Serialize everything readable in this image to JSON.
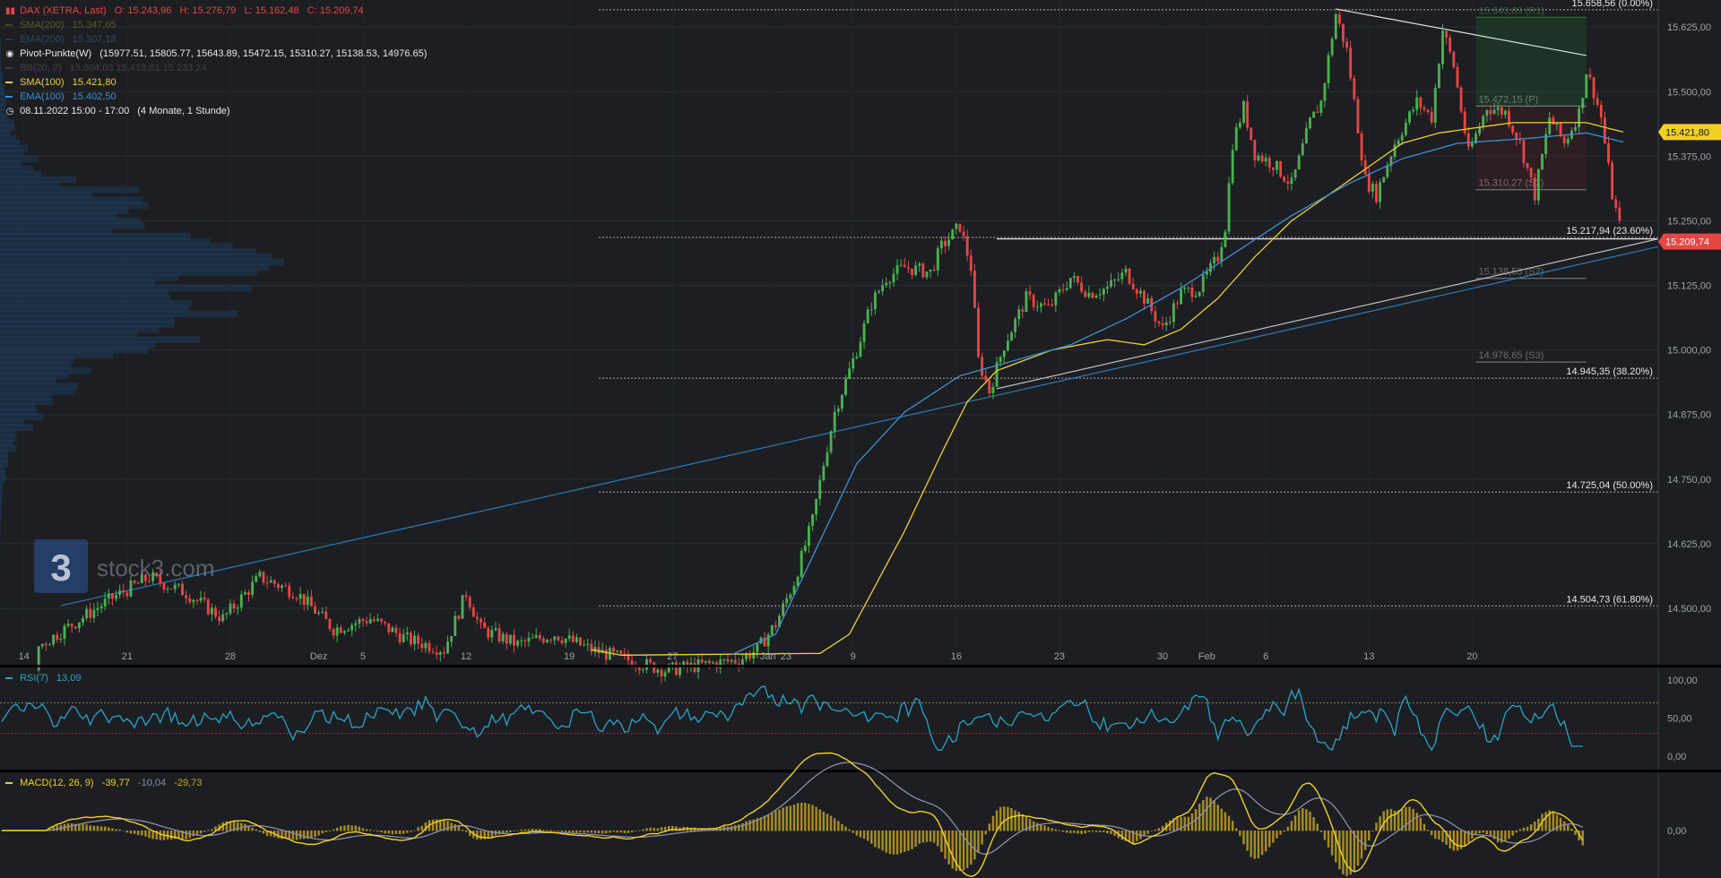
{
  "instrument": {
    "name": "DAX (XETRA, Last)",
    "open": "O: 15.243,96",
    "high": "H: 15.276,79",
    "low": "L: 15.162,48",
    "close": "C: 15.209,74",
    "color": "#e64545"
  },
  "legend": {
    "sma200": {
      "label": "SMA(200)",
      "value": "15.347,65",
      "color": "#9a8c24"
    },
    "ema200": {
      "label": "EMA(200)",
      "value": "15.307,18",
      "color": "#3a6d95"
    },
    "pivot": {
      "label": "Pivot-Punkte(W)",
      "value": "(15977.51,  15805.77,  15643.89,  15472.15,  15310.27,  15138.53,  14976.65)"
    },
    "bbands": {
      "label": "BB(20, 2)",
      "value": "15.604,03  15.418,61  15.233,24"
    },
    "sma100": {
      "label": "SMA(100)",
      "value": "15.421,80",
      "color": "#f2d024"
    },
    "ema100": {
      "label": "EMA(100)",
      "value": "15.402,50",
      "color": "#3d8fd6"
    },
    "range": {
      "label": "08.11.2022 15:00 - 17:00",
      "value": "(4 Monate, 1 Stunde)"
    }
  },
  "watermark": {
    "logo_text": "3",
    "brand": "stock3.com"
  },
  "price_axis": {
    "ticks": [
      "15.625,00",
      "15.500,00",
      "15.375,00",
      "15.250,00",
      "15.125,00",
      "15.000,00",
      "14.875,00",
      "14.750,00",
      "14.625,00",
      "14.500,00"
    ],
    "tick_values": [
      15625,
      15500,
      15375,
      15250,
      15125,
      15000,
      14875,
      14750,
      14625,
      14500
    ],
    "range": [
      14415,
      15660
    ],
    "badges": [
      {
        "text": "15.421,80",
        "value": 15421.8,
        "color": "#f2d024",
        "text_color": "#111111"
      },
      {
        "text": "15.209,74",
        "value": 15209.74,
        "color": "#e64545",
        "text_color": "#ffffff"
      }
    ]
  },
  "time_axis": {
    "labels": [
      "14",
      "21",
      "28",
      "Dez",
      "5",
      "12",
      "19",
      "27",
      "Jan '23",
      "9",
      "16",
      "23",
      "30",
      "Feb",
      "6",
      "13",
      "20"
    ],
    "label_index": [
      6,
      34,
      62,
      86,
      98,
      126,
      154,
      182,
      210,
      231,
      259,
      287,
      315,
      327,
      343,
      371,
      399
    ],
    "bars_total": 430
  },
  "fibonacci": [
    {
      "value": 15658.56,
      "text": "15.658,56 (0.00%)"
    },
    {
      "value": 15217.94,
      "text": "15.217,94 (23.60%)"
    },
    {
      "value": 14945.35,
      "text": "14.945,35 (38.20%)"
    },
    {
      "value": 14725.04,
      "text": "14.725,04 (50.00%)"
    },
    {
      "value": 14504.73,
      "text": "14.504,73 (61.80%)"
    }
  ],
  "pivot_levels": [
    {
      "value": 15643.89,
      "text": "15.643,89 (R1)",
      "color": "#4caf50"
    },
    {
      "value": 15472.15,
      "text": "15.472,15 (P)",
      "color": "#c8c8c8"
    },
    {
      "value": 15310.27,
      "text": "15.310,27 (S1)",
      "color": "#c8c8c8"
    },
    {
      "value": 15138.53,
      "text": "15.138,53 (S2)",
      "color": "#c8c8c8"
    },
    {
      "value": 14976.65,
      "text": "14.976,65 (S3)",
      "color": "#c8c8c8"
    }
  ],
  "rsi": {
    "label": "RSI(7)",
    "value": "13,09",
    "color": "#29a3c9",
    "ticks": [
      "100,00",
      "50,00",
      "0,00"
    ],
    "tick_values": [
      100,
      50,
      0
    ],
    "upper": 70,
    "lower": 30
  },
  "macd": {
    "label": "MACD(12, 26, 9)",
    "value": "-39,77",
    "signal": "-10,04",
    "hist": "-29,73",
    "ticks": [
      "0,00"
    ],
    "line_color": "#f2d024",
    "signal_color": "#8a8fa8",
    "hist_color": "#c9a825"
  },
  "chart_data": {
    "type": "candlestick",
    "title": "DAX (XETRA, Last)",
    "ylim": [
      14415,
      15660
    ],
    "anchor_closes": [
      [
        0,
        14380
      ],
      [
        30,
        14520
      ],
      [
        40,
        14560
      ],
      [
        50,
        14530
      ],
      [
        60,
        14480
      ],
      [
        70,
        14560
      ],
      [
        80,
        14530
      ],
      [
        90,
        14460
      ],
      [
        100,
        14480
      ],
      [
        110,
        14440
      ],
      [
        120,
        14420
      ],
      [
        126,
        14530
      ],
      [
        130,
        14460
      ],
      [
        140,
        14430
      ],
      [
        150,
        14450
      ],
      [
        160,
        14420
      ],
      [
        170,
        14400
      ],
      [
        180,
        14380
      ],
      [
        190,
        14390
      ],
      [
        200,
        14400
      ],
      [
        205,
        14420
      ],
      [
        210,
        14470
      ],
      [
        215,
        14550
      ],
      [
        220,
        14670
      ],
      [
        223,
        14780
      ],
      [
        226,
        14880
      ],
      [
        232,
        15000
      ],
      [
        236,
        15090
      ],
      [
        240,
        15140
      ],
      [
        245,
        15160
      ],
      [
        252,
        15150
      ],
      [
        255,
        15200
      ],
      [
        260,
        15240
      ],
      [
        263,
        15160
      ],
      [
        265,
        14980
      ],
      [
        268,
        14920
      ],
      [
        272,
        15010
      ],
      [
        278,
        15100
      ],
      [
        284,
        15080
      ],
      [
        290,
        15140
      ],
      [
        295,
        15110
      ],
      [
        300,
        15120
      ],
      [
        305,
        15150
      ],
      [
        310,
        15100
      ],
      [
        315,
        15040
      ],
      [
        320,
        15110
      ],
      [
        325,
        15120
      ],
      [
        330,
        15180
      ],
      [
        332,
        15240
      ],
      [
        334,
        15400
      ],
      [
        337,
        15470
      ],
      [
        340,
        15380
      ],
      [
        345,
        15360
      ],
      [
        350,
        15320
      ],
      [
        355,
        15440
      ],
      [
        358,
        15480
      ],
      [
        362,
        15650
      ],
      [
        365,
        15580
      ],
      [
        370,
        15330
      ],
      [
        373,
        15300
      ],
      [
        378,
        15400
      ],
      [
        384,
        15480
      ],
      [
        388,
        15450
      ],
      [
        391,
        15620
      ],
      [
        394,
        15550
      ],
      [
        398,
        15380
      ],
      [
        403,
        15470
      ],
      [
        408,
        15460
      ],
      [
        412,
        15400
      ],
      [
        416,
        15300
      ],
      [
        420,
        15450
      ],
      [
        424,
        15400
      ],
      [
        428,
        15460
      ],
      [
        430,
        15540
      ],
      [
        432,
        15500
      ],
      [
        434,
        15450
      ],
      [
        437,
        15300
      ],
      [
        440,
        15209.74
      ]
    ],
    "sma100_anchors": [
      [
        160,
        14420
      ],
      [
        175,
        14400
      ],
      [
        195,
        14380
      ],
      [
        215,
        14380
      ],
      [
        230,
        14450
      ],
      [
        245,
        14650
      ],
      [
        255,
        14800
      ],
      [
        262,
        14900
      ],
      [
        270,
        14960
      ],
      [
        285,
        15000
      ],
      [
        300,
        15020
      ],
      [
        310,
        15010
      ],
      [
        320,
        15040
      ],
      [
        330,
        15100
      ],
      [
        340,
        15180
      ],
      [
        350,
        15250
      ],
      [
        360,
        15300
      ],
      [
        370,
        15350
      ],
      [
        380,
        15400
      ],
      [
        390,
        15420
      ],
      [
        410,
        15440
      ],
      [
        425,
        15440
      ],
      [
        430,
        15440
      ],
      [
        440,
        15421.8
      ]
    ],
    "ema100_anchors": [
      [
        195,
        14400
      ],
      [
        210,
        14450
      ],
      [
        220,
        14600
      ],
      [
        232,
        14780
      ],
      [
        245,
        14880
      ],
      [
        260,
        14950
      ],
      [
        275,
        14980
      ],
      [
        290,
        15010
      ],
      [
        305,
        15060
      ],
      [
        320,
        15120
      ],
      [
        335,
        15190
      ],
      [
        350,
        15260
      ],
      [
        365,
        15320
      ],
      [
        380,
        15370
      ],
      [
        395,
        15400
      ],
      [
        415,
        15410
      ],
      [
        430,
        15420
      ],
      [
        440,
        15402.5
      ]
    ],
    "trendlines": [
      {
        "from": [
          362,
          15660
        ],
        "to": [
          430,
          15570
        ],
        "color": "#e0e0e0"
      },
      {
        "from": [
          270,
          15215
        ],
        "to": [
          440,
          15215
        ],
        "color": "#e0e0e0"
      },
      {
        "from": [
          270,
          14925
        ],
        "to": [
          440,
          15215
        ],
        "color": "#bdbdbd"
      },
      {
        "from": [
          16,
          14505
        ],
        "to": [
          440,
          15200
        ],
        "color": "#2f7ab8"
      }
    ]
  }
}
